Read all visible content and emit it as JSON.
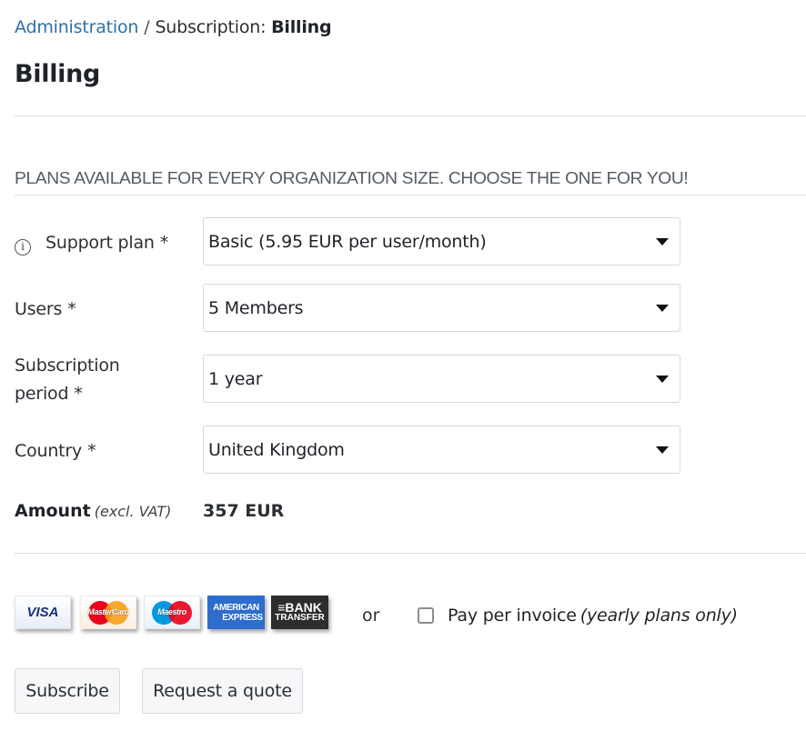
{
  "breadcrumb": {
    "link": "Administration",
    "separator": "/",
    "prefix": "Subscription:",
    "current": "Billing"
  },
  "page_title": "Billing",
  "section_heading": "PLANS AVAILABLE FOR EVERY ORGANIZATION SIZE. CHOOSE THE ONE FOR YOU!",
  "fields": {
    "support_plan": {
      "label": "Support plan",
      "required": "*",
      "icon": "info-icon",
      "value": "Basic (5.95 EUR per user/month)"
    },
    "users": {
      "label": "Users",
      "required": "*",
      "value": "5 Members"
    },
    "subscription_period": {
      "label_line1": "Subscription",
      "label_line2": "period",
      "required": "*",
      "value": "1 year"
    },
    "country": {
      "label": "Country",
      "required": "*",
      "value": "United Kingdom"
    }
  },
  "amount": {
    "label": "Amount",
    "note": "(excl. VAT)",
    "value": "357 EUR"
  },
  "payment": {
    "cards": {
      "visa": "VISA",
      "mastercard": "MasterCard",
      "maestro": "Maestro",
      "amex_line1": "AMERICAN",
      "amex_line2": "EXPRESS",
      "bank_line1": "≡BANK",
      "bank_line2": "TRANSFER"
    },
    "or_text": "or",
    "invoice_label": "Pay per invoice",
    "invoice_note": "(yearly plans only)",
    "invoice_checked": false
  },
  "buttons": {
    "subscribe": "Subscribe",
    "request_quote": "Request a quote"
  },
  "colors": {
    "link": "#2f6fa6",
    "amex": "#2e6dcc",
    "bank": "#2d2d2d",
    "mc_red": "#eb001b",
    "mc_orange": "#f79e1b",
    "maestro_blue": "#0099df"
  }
}
